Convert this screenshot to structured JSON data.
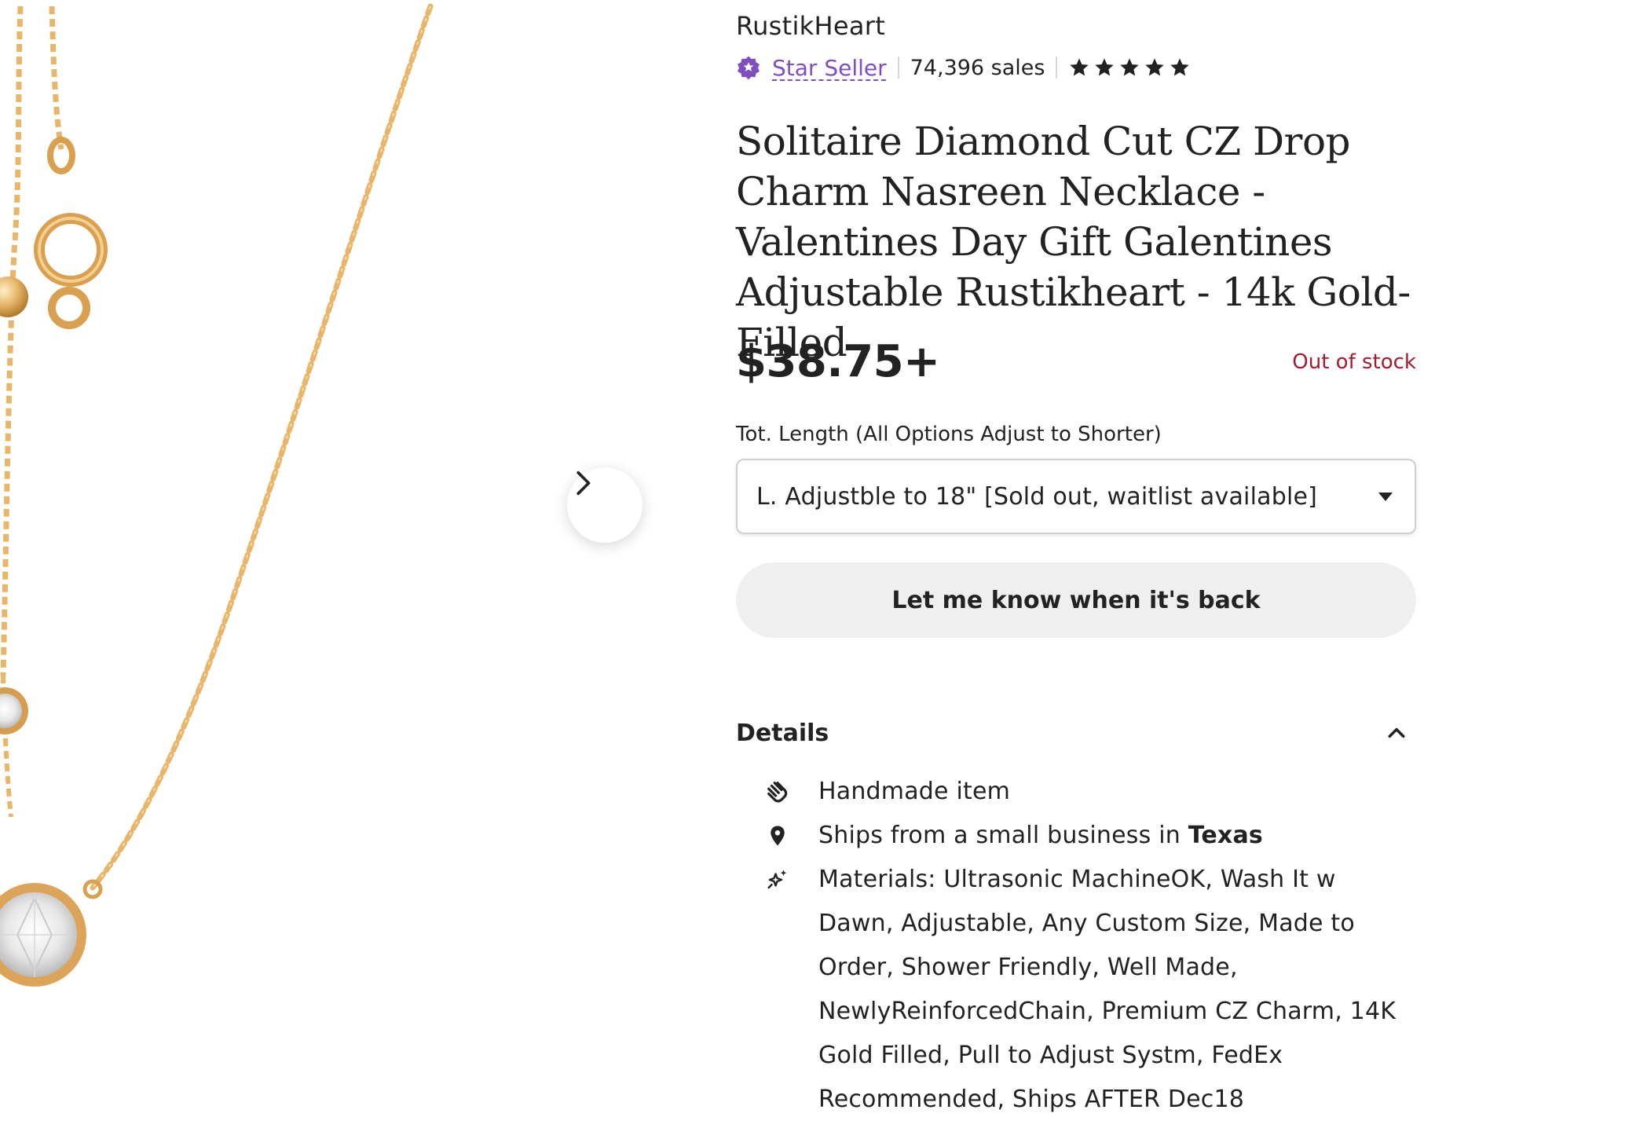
{
  "listing": {
    "shop_name": "RustikHeart",
    "star_seller_label": "Star Seller",
    "sales_text": "74,396 sales",
    "rating_stars": 5,
    "title": "Solitaire Diamond Cut CZ Drop Charm Nasreen Necklace - Valentines Day Gift Galentines Adjustable Rustikheart - 14k Gold-Filled",
    "price": "$38.75+",
    "stock_status": "Out of stock"
  },
  "variant": {
    "label": "Tot. Length (All Options Adjust to Shorter)",
    "selected": "L. Adjustble to 18\" [Sold out, waitlist available]"
  },
  "actions": {
    "notify_label": "Let me know when it's back"
  },
  "details": {
    "heading": "Details",
    "handmade": "Handmade item",
    "ships_prefix": "Ships from a small business in ",
    "ships_location": "Texas",
    "materials": "Materials: Ultrasonic MachineOK, Wash It w Dawn, Adjustable, Any Custom Size, Made to Order, Shower Friendly, Well Made, NewlyReinforcedChain, Premium CZ Charm, 14K Gold Filled, Pull to Adjust Systm, FedEx Recommended, Ships AFTER Dec18"
  },
  "icons": {
    "star_seller_badge": "star-seller-badge-icon",
    "rating_star": "star-icon",
    "next": "chevron-right-icon",
    "dropdown": "caret-down-icon",
    "collapse": "chevron-up-icon",
    "handmade": "hand-icon",
    "location": "location-pin-icon",
    "materials": "sparkle-icon"
  },
  "colors": {
    "star_seller": "#7f4fc0",
    "out_of_stock": "#a61a2e",
    "gold_chain": "#e8b56a",
    "button_bg": "#efefef"
  }
}
